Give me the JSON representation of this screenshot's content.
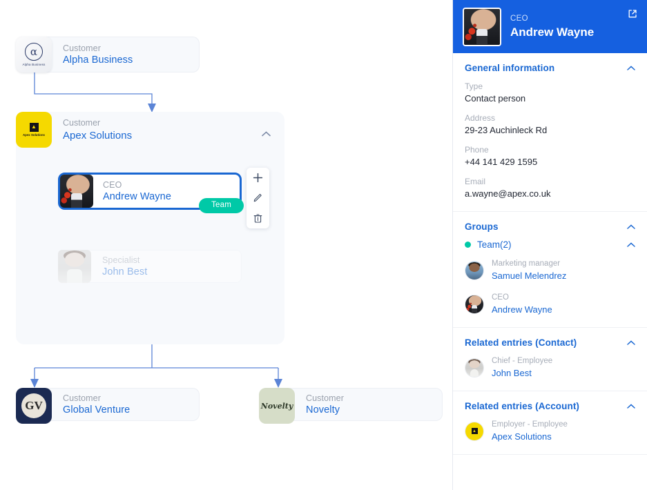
{
  "graph": {
    "nodes": {
      "alpha": {
        "role": "Customer",
        "name": "Alpha Business",
        "logo_text": "Alpha Business",
        "logo_glyph": "α"
      },
      "apex": {
        "role": "Customer",
        "name": "Apex Solutions",
        "logo_text": "Apex Solutions",
        "logo_glyph": "▲"
      },
      "ceo": {
        "role": "CEO",
        "name": "Andrew Wayne",
        "badge": "Team"
      },
      "specialist": {
        "role": "Specialist",
        "name": "John Best"
      },
      "global_venture": {
        "role": "Customer",
        "name": "Global Venture",
        "logo_text": "GV"
      },
      "novelty": {
        "role": "Customer",
        "name": "Novelty",
        "logo_text": "Novelty"
      }
    },
    "toolbar": {
      "add_label": "+",
      "edit_label": "edit",
      "delete_label": "delete"
    },
    "colors": {
      "edge": "#5b84d6",
      "selected_border": "#1967d2",
      "badge": "#00c9a7",
      "apex_yellow": "#f5d900",
      "gv_navy": "#1b2a52",
      "novelty_green": "#d6ddc8"
    }
  },
  "panel": {
    "header": {
      "role": "CEO",
      "name": "Andrew Wayne",
      "open_icon": "external-link-icon"
    },
    "general": {
      "title": "General information",
      "fields": [
        {
          "label": "Type",
          "value": "Contact person"
        },
        {
          "label": "Address",
          "value": "29-23 Auchinleck Rd"
        },
        {
          "label": "Phone",
          "value": "+44 141 429 1595"
        },
        {
          "label": "Email",
          "value": "a.wayne@apex.co.uk"
        }
      ]
    },
    "groups": {
      "title": "Groups",
      "group_name": "Team(2)",
      "members": [
        {
          "role": "Marketing manager",
          "name": "Samuel Melendrez"
        },
        {
          "role": "CEO",
          "name": "Andrew Wayne"
        }
      ]
    },
    "related_contact": {
      "title": "Related entries (Contact)",
      "items": [
        {
          "role": "Chief - Employee",
          "name": "John Best"
        }
      ]
    },
    "related_account": {
      "title": "Related entries (Account)",
      "items": [
        {
          "role": "Employer - Employee",
          "name": "Apex Solutions"
        }
      ]
    }
  }
}
